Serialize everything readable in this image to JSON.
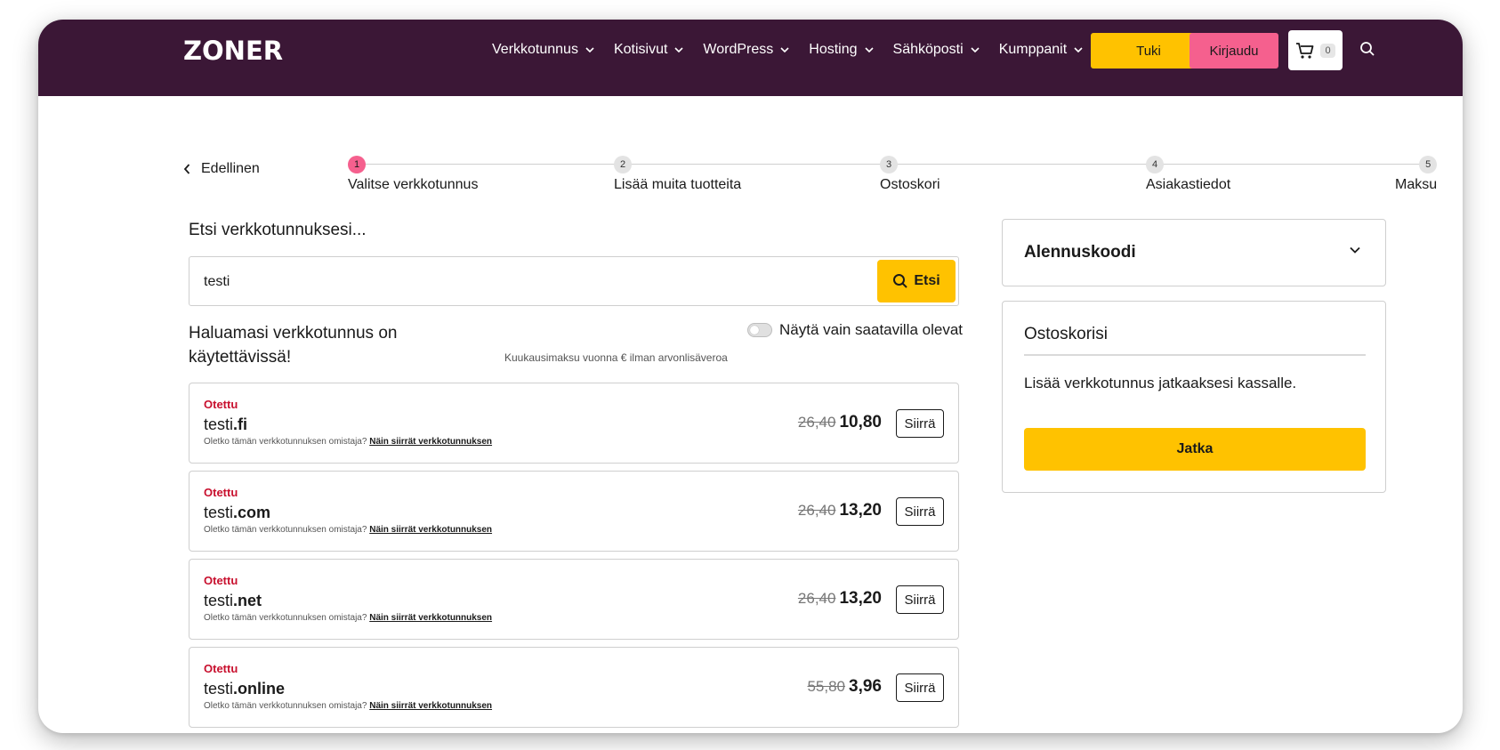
{
  "header": {
    "logo": "ZONER",
    "nav": [
      {
        "label": "Verkkotunnus"
      },
      {
        "label": "Kotisivut"
      },
      {
        "label": "WordPress"
      },
      {
        "label": "Hosting"
      },
      {
        "label": "Sähköposti"
      },
      {
        "label": "Kumppanit"
      }
    ],
    "support_label": "Tuki",
    "login_label": "Kirjaudu",
    "cart_count": "0",
    "colors": {
      "background": "#3b1736",
      "support": "#ffc200",
      "login": "#f5608e"
    }
  },
  "stepper": {
    "back_label": "Edellinen",
    "steps": [
      {
        "num": "1",
        "label": "Valitse verkkotunnus",
        "active": true
      },
      {
        "num": "2",
        "label": "Lisää muita tuotteita"
      },
      {
        "num": "3",
        "label": "Ostoskori"
      },
      {
        "num": "4",
        "label": "Asiakastiedot"
      },
      {
        "num": "5",
        "label": "Maksu"
      }
    ]
  },
  "search": {
    "title": "Etsi verkkotunnuksesi...",
    "value": "testi",
    "button_label": "Etsi"
  },
  "results": {
    "title": "Haluamasi verkkotunnus on käytettävissä!",
    "toggle_label": "Näytä vain saatavilla olevat",
    "price_note": "Kuukausimaksu vuonna € ilman arvonlisäveroa",
    "owner_question": "Oletko tämän verkkotunnuksen omistaja?",
    "owner_link": "Näin siirrät verkkotunnuksen",
    "action_label": "Siirrä",
    "items": [
      {
        "status": "Otettu",
        "name": "testi",
        "tld": ".fi",
        "old_price": "26,40",
        "price": "10,80"
      },
      {
        "status": "Otettu",
        "name": "testi",
        "tld": ".com",
        "old_price": "26,40",
        "price": "13,20"
      },
      {
        "status": "Otettu",
        "name": "testi",
        "tld": ".net",
        "old_price": "26,40",
        "price": "13,20"
      },
      {
        "status": "Otettu",
        "name": "testi",
        "tld": ".online",
        "old_price": "55,80",
        "price": "3,96"
      }
    ]
  },
  "sidebar": {
    "coupon_title": "Alennuskoodi",
    "cart_title": "Ostoskorisi",
    "cart_empty": "Lisää verkkotunnus jatkaaksesi kassalle.",
    "continue_label": "Jatka"
  }
}
